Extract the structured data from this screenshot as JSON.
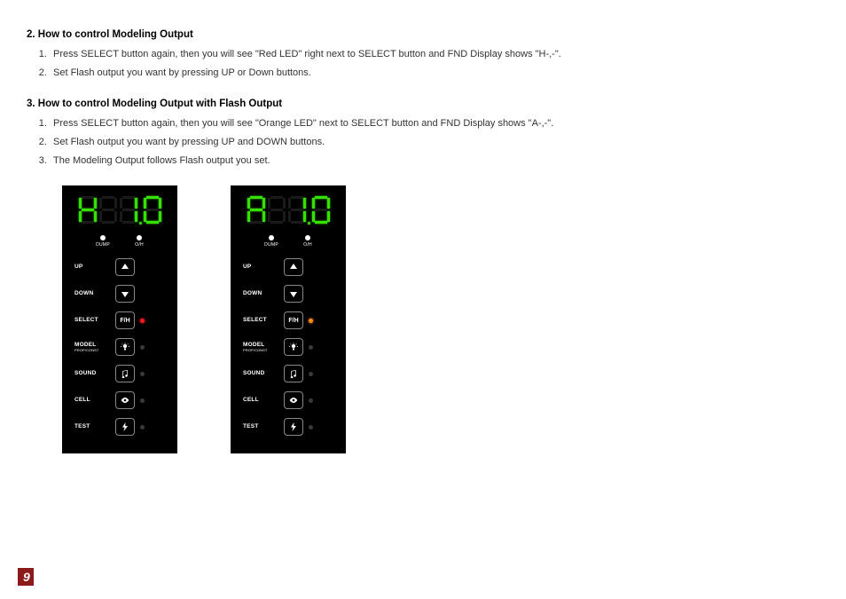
{
  "section2": {
    "heading": "2. How to control Modeling Output",
    "steps": [
      "Press SELECT button again, then you will see \"Red LED\" right next to SELECT button and FND Display shows \"H-,-\".",
      "Set Flash output you want by pressing UP or Down buttons."
    ]
  },
  "section3": {
    "heading": "3. How to control Modeling Output with Flash Output",
    "steps": [
      "Press SELECT button again, then you will see \"Orange LED\" next to SELECT button and FND Display shows \"A-,-\".",
      "Set Flash output you want by pressing UP and DOWN buttons.",
      "The Modeling Output follows Flash output you set."
    ]
  },
  "panels": {
    "dump_label": "DUMP",
    "oh_label": "O/H",
    "buttons": {
      "up": "UP",
      "down": "DOWN",
      "select": "SELECT",
      "select_btn": "F/H",
      "model": "MODEL",
      "model_sub": "PROP/CONST",
      "sound": "SOUND",
      "cell": "CELL",
      "test": "TEST"
    },
    "left": {
      "fnd": "H 1.0",
      "select_led": "red"
    },
    "right": {
      "fnd": "A 1.0",
      "select_led": "orange"
    }
  },
  "page_number": "9"
}
